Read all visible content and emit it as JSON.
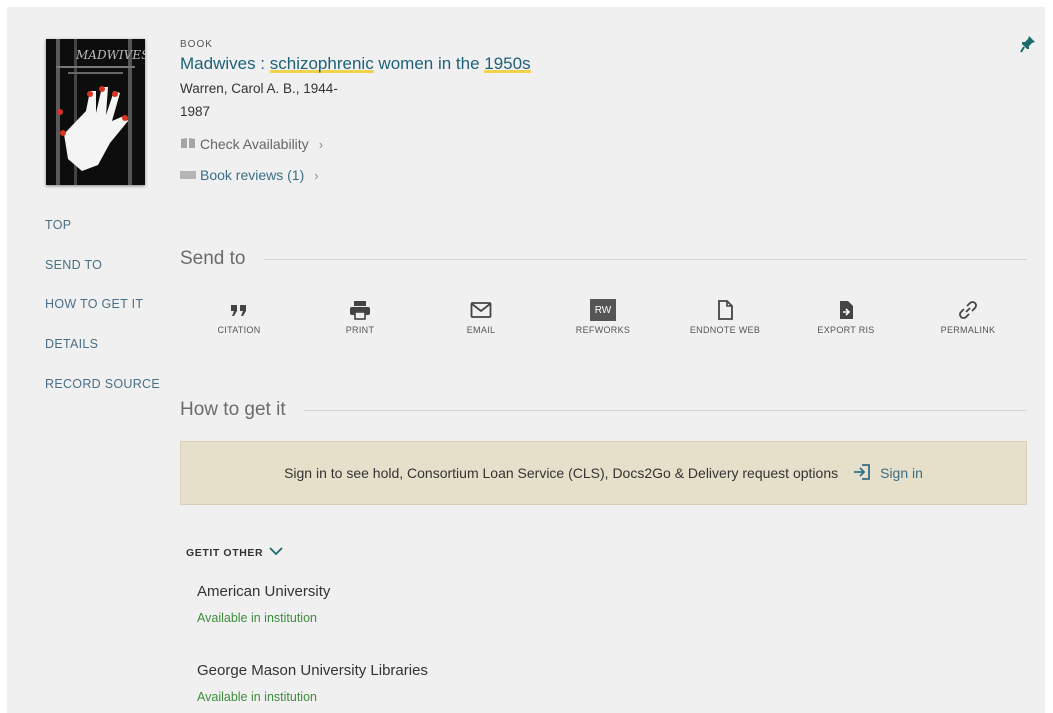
{
  "record": {
    "type": "BOOK",
    "title_part1": "Madwives : ",
    "title_hl1": "schizophrenic",
    "title_part2": " women in the ",
    "title_hl2": "1950s",
    "author": "Warren, Carol A. B., 1944-",
    "year": "1987",
    "check_availability": "Check Availability",
    "book_reviews": "Book reviews (1)"
  },
  "nav": [
    "TOP",
    "SEND TO",
    "HOW TO GET IT",
    "DETAILS",
    "RECORD SOURCE"
  ],
  "send_to": {
    "heading": "Send to",
    "actions": [
      {
        "label": "CITATION",
        "icon": "quote-icon"
      },
      {
        "label": "PRINT",
        "icon": "printer-icon"
      },
      {
        "label": "EMAIL",
        "icon": "envelope-icon"
      },
      {
        "label": "REFWORKS",
        "icon": "refworks-icon",
        "badge": "RW"
      },
      {
        "label": "ENDNOTE WEB",
        "icon": "document-icon"
      },
      {
        "label": "EXPORT RIS",
        "icon": "export-file-icon"
      },
      {
        "label": "PERMALINK",
        "icon": "link-icon"
      }
    ]
  },
  "how_to_get": {
    "heading": "How to get it",
    "signin_message": "Sign in to see hold, Consortium Loan Service (CLS), Docs2Go & Delivery request options",
    "signin_label": "Sign in",
    "getit_label": "GETIT OTHER",
    "institutions": [
      {
        "name": "American University",
        "status": "Available in institution"
      },
      {
        "name": "George Mason University Libraries",
        "status": "Available in institution"
      }
    ]
  },
  "colors": {
    "link": "#1e6178",
    "highlight": "#f1d24a",
    "available": "#3f8c3f",
    "signin_bg": "#e6dfca"
  }
}
